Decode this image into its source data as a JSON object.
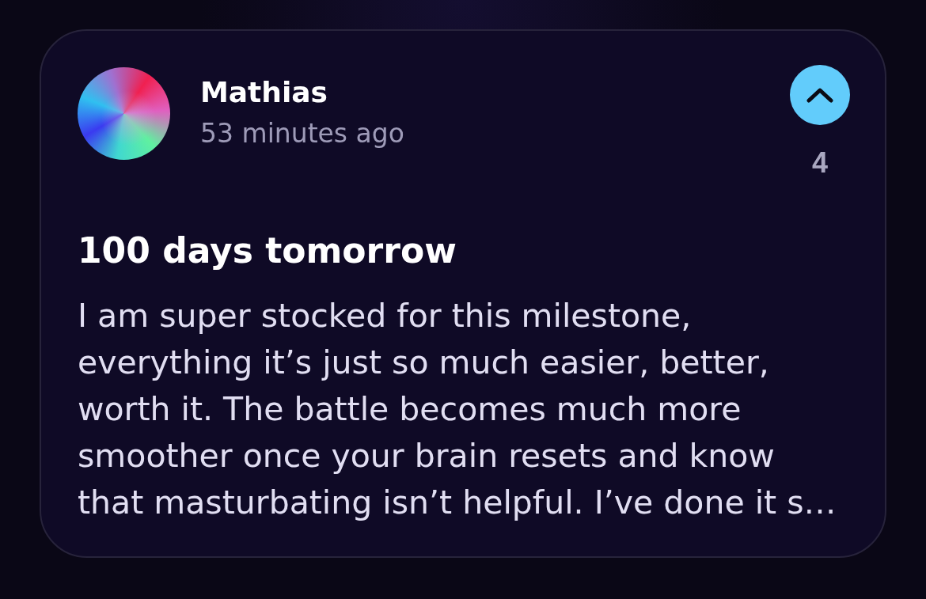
{
  "post": {
    "author": {
      "name": "Mathias",
      "time": "53 minutes ago"
    },
    "upvote": {
      "upvoted": true,
      "count": "4"
    },
    "title": "100 days tomorrow",
    "body": "I am super stocked for this milestone, everything it’s just so much easier, better, worth it. The battle becomes much more smoother once your brain resets and know that masturbating isn’t helpful. I’ve done it s…"
  }
}
